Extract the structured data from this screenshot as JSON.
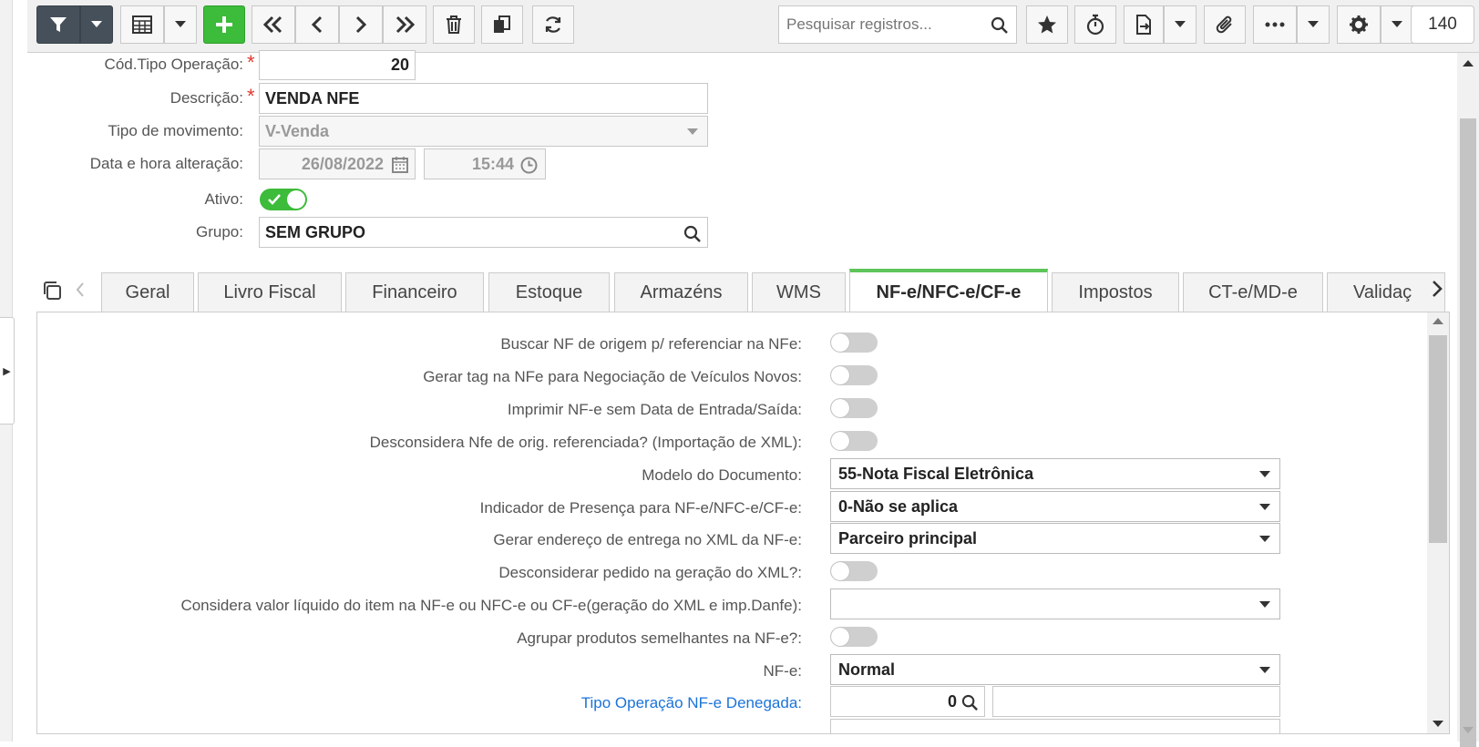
{
  "toolbar": {
    "search_placeholder": "Pesquisar registros...",
    "record_count": "140"
  },
  "form": {
    "cod_tipo_label": "Cód.Tipo Operação:",
    "cod_tipo_value": "20",
    "descricao_label": "Descrição:",
    "descricao_value": "VENDA NFE",
    "tipo_mov_label": "Tipo de movimento:",
    "tipo_mov_value": "V-Venda",
    "data_label": "Data e hora alteração:",
    "date_value": "26/08/2022",
    "time_value": "15:44",
    "ativo_label": "Ativo:",
    "ativo_on": true,
    "grupo_label": "Grupo:",
    "grupo_value": "SEM GRUPO",
    "required_mark": "*"
  },
  "tabs": [
    {
      "label": "Geral"
    },
    {
      "label": "Livro Fiscal"
    },
    {
      "label": "Financeiro"
    },
    {
      "label": "Estoque"
    },
    {
      "label": "Armazéns"
    },
    {
      "label": "WMS"
    },
    {
      "label": "NF-e/NFC-e/CF-e",
      "active": true
    },
    {
      "label": "Impostos"
    },
    {
      "label": "CT-e/MD-e"
    },
    {
      "label": "Validaç"
    }
  ],
  "panel": {
    "buscar_nf": "Buscar NF de origem p/ referenciar na NFe:",
    "gerar_tag": "Gerar tag na NFe para Negociação de Veículos Novos:",
    "imprimir": "Imprimir NF-e sem Data de Entrada/Saída:",
    "desconsidera_nfe": "Desconsidera Nfe de orig. referenciada? (Importação de XML):",
    "modelo_label": "Modelo do Documento:",
    "modelo_value": "55-Nota Fiscal Eletrônica",
    "indicador_label": "Indicador de Presença para NF-e/NFC-e/CF-e:",
    "indicador_value": "0-Não se aplica",
    "endereco_label": "Gerar endereço de entrega no XML da NF-e:",
    "endereco_value": "Parceiro principal",
    "desconsiderar_pedido": "Desconsiderar pedido na geração do XML?:",
    "considera_label": "Considera valor líquido do item na NF-e ou NFC-e ou CF-e(geração do XML e imp.Danfe):",
    "considera_value": "",
    "agrupar": "Agrupar produtos semelhantes na NF-e?:",
    "nfe_label": "NF-e:",
    "nfe_value": "Normal",
    "denegada_label": "Tipo Operação NF-e Denegada:",
    "denegada_value": "0",
    "denegada_desc": ""
  },
  "colors": {
    "accent_green": "#3dbb3a",
    "active_tab_border": "#5dc55a",
    "required": "#e03a2f",
    "link": "#1a73d9"
  }
}
